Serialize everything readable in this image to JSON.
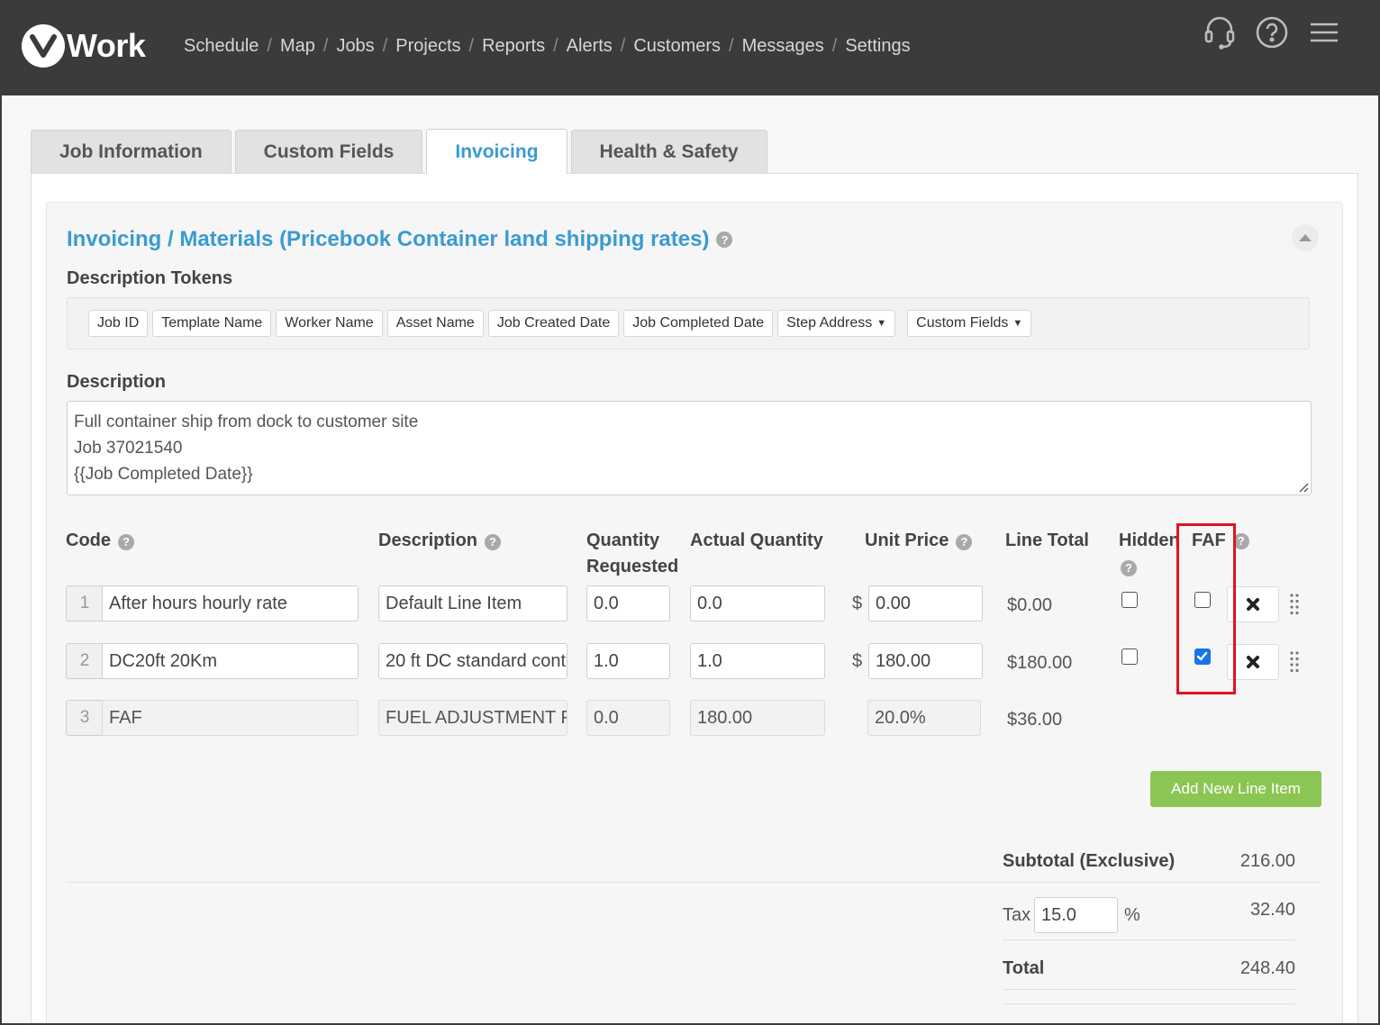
{
  "brand": {
    "logo_letter": "v",
    "logo_word": "Work"
  },
  "nav": {
    "items": [
      "Schedule",
      "Map",
      "Jobs",
      "Projects",
      "Reports",
      "Alerts",
      "Customers",
      "Messages",
      "Settings"
    ],
    "separator": "/"
  },
  "top_icons": [
    "headset-icon",
    "help-circle-icon",
    "hamburger-menu-icon"
  ],
  "tabs": [
    {
      "label": "Job Information",
      "active": false
    },
    {
      "label": "Custom Fields",
      "active": false
    },
    {
      "label": "Invoicing",
      "active": true
    },
    {
      "label": "Health & Safety",
      "active": false
    }
  ],
  "panel": {
    "title": "Invoicing / Materials (Pricebook Container land shipping rates)",
    "help": "?"
  },
  "tokens": {
    "label": "Description Tokens",
    "items": [
      "Job ID",
      "Template Name",
      "Worker Name",
      "Asset Name",
      "Job Created Date",
      "Job Completed Date"
    ],
    "dropdowns": [
      "Step Address",
      "Custom Fields"
    ]
  },
  "description": {
    "label": "Description",
    "lines": [
      "Full container ship from dock to customer site",
      "Job 37021540",
      "{{Job Completed Date}}"
    ]
  },
  "columns": {
    "code": "Code",
    "description": "Description",
    "qty_requested_1": "Quantity",
    "qty_requested_2": "Requested",
    "actual_quantity": "Actual Quantity",
    "unit_price": "Unit Price",
    "line_total": "Line Total",
    "hidden": "Hidden",
    "faf": "FAF"
  },
  "line_items": [
    {
      "num": "1",
      "code": "After hours hourly rate",
      "description": "Default Line Item",
      "qty_requested": "0.0",
      "actual_qty": "0.0",
      "currency": "$",
      "unit_price": "0.00",
      "line_total": "$0.00",
      "hidden": false,
      "faf": false
    },
    {
      "num": "2",
      "code": "DC20ft 20Km",
      "description": "20 ft DC standard cont",
      "qty_requested": "1.0",
      "actual_qty": "1.0",
      "currency": "$",
      "unit_price": "180.00",
      "line_total": "$180.00",
      "hidden": false,
      "faf": true
    },
    {
      "num": "3",
      "code": "FAF",
      "description": "FUEL ADJUSTMENT F",
      "qty_requested": "0.0",
      "actual_qty": "180.00",
      "unit_price": "20.0%",
      "line_total": "$36.00"
    }
  ],
  "add_button": "Add New Line Item",
  "summary": {
    "subtotal_label": "Subtotal (Exclusive)",
    "subtotal_value": "216.00",
    "tax_label": "Tax",
    "tax_rate": "15.0",
    "tax_unit": "%",
    "tax_value": "32.40",
    "total_label": "Total",
    "total_value": "248.40"
  },
  "colors": {
    "accent": "#3a9bd1",
    "topbar": "#3b3b3b",
    "add_button": "#8bc553",
    "highlight": "#e0141e",
    "checkbox_checked": "#1a73e8"
  }
}
